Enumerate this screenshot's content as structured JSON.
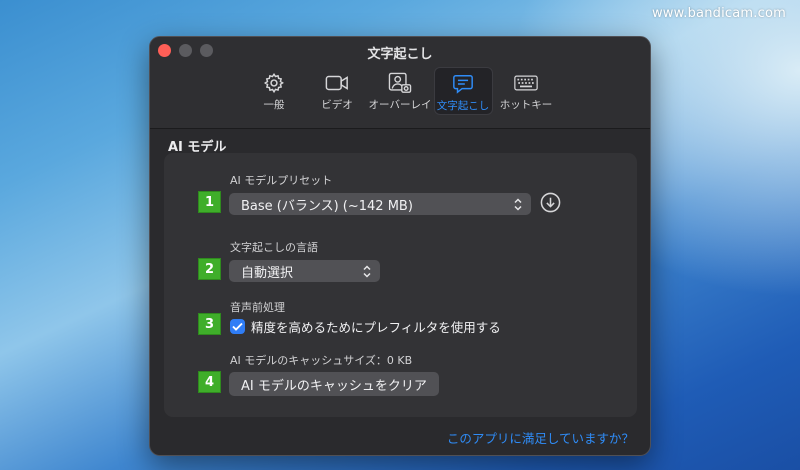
{
  "watermark": "www.bandicam.com",
  "window": {
    "title": "文字起こし",
    "tabs": [
      {
        "label": "一般",
        "icon": "gear-icon",
        "active": false
      },
      {
        "label": "ビデオ",
        "icon": "video-camera-icon",
        "active": false
      },
      {
        "label": "オーバーレイ",
        "icon": "person-camera-icon",
        "active": false
      },
      {
        "label": "文字起こし",
        "icon": "speech-bubble-icon",
        "active": true
      },
      {
        "label": "ホットキー",
        "icon": "keyboard-icon",
        "active": false
      }
    ]
  },
  "section": {
    "title": "AI モデル"
  },
  "settings": {
    "preset_label": "AI モデルプリセット",
    "preset_value": "Base (バランス) (~142 MB)",
    "language_label": "文字起こしの言語",
    "language_value": "自動選択",
    "preprocess_label": "音声前処理",
    "prefilter_label": "精度を高めるためにプレフィルタを使用する",
    "prefilter_checked": true,
    "cache_label": "AI モデルのキャッシュサイズ：0 KB",
    "clear_cache_label": "AI モデルのキャッシュをクリア"
  },
  "badges": [
    "1",
    "2",
    "3",
    "4"
  ],
  "footer": {
    "feedback_link": "このアプリに満足していますか？"
  },
  "colors": {
    "accent": "#2f8cf7",
    "badge_green": "#3fae2a",
    "close_red": "#fe5f57"
  }
}
